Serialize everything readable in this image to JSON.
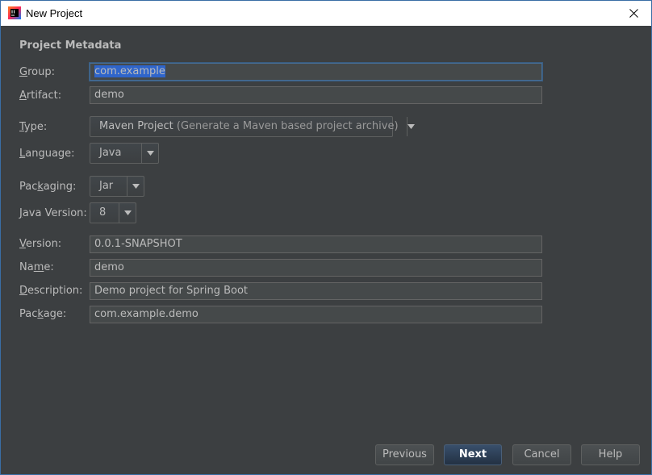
{
  "window": {
    "title": "New Project"
  },
  "section": {
    "title": "Project Metadata"
  },
  "form": {
    "group": {
      "label_pre": "",
      "label_u": "G",
      "label_post": "roup:",
      "value": "com.example"
    },
    "artifact": {
      "label_pre": "",
      "label_u": "A",
      "label_post": "rtifact:",
      "value": "demo"
    },
    "type": {
      "label_pre": "",
      "label_u": "T",
      "label_post": "ype:",
      "value": "Maven Project",
      "hint": "(Generate a Maven based project archive)"
    },
    "language": {
      "label_pre": "",
      "label_u": "L",
      "label_post": "anguage:",
      "value": "Java"
    },
    "packaging": {
      "label_pre": "Pac",
      "label_u": "k",
      "label_post": "aging:",
      "value": "Jar"
    },
    "java_version": {
      "label_pre": "",
      "label_u": "J",
      "label_post": "ava Version:",
      "value": "8"
    },
    "version": {
      "label_pre": "",
      "label_u": "V",
      "label_post": "ersion:",
      "value": "0.0.1-SNAPSHOT"
    },
    "name": {
      "label_pre": "Na",
      "label_u": "m",
      "label_post": "e:",
      "value": "demo"
    },
    "description": {
      "label_pre": "",
      "label_u": "D",
      "label_post": "escription:",
      "value": "Demo project for Spring Boot"
    },
    "package": {
      "label_pre": "Pac",
      "label_u": "k",
      "label_post": "age:",
      "value": "com.example.demo"
    }
  },
  "buttons": {
    "previous": "Previous",
    "next": "Next",
    "cancel": "Cancel",
    "help": "Help"
  },
  "icons": {
    "app": "intellij-idea-icon",
    "close": "close-icon",
    "dropdown": "triangle-down-icon"
  },
  "colors": {
    "background": "#3c3f41",
    "text": "#bbbbbb",
    "selection": "#2f65ca",
    "focus_border": "#466d94"
  }
}
